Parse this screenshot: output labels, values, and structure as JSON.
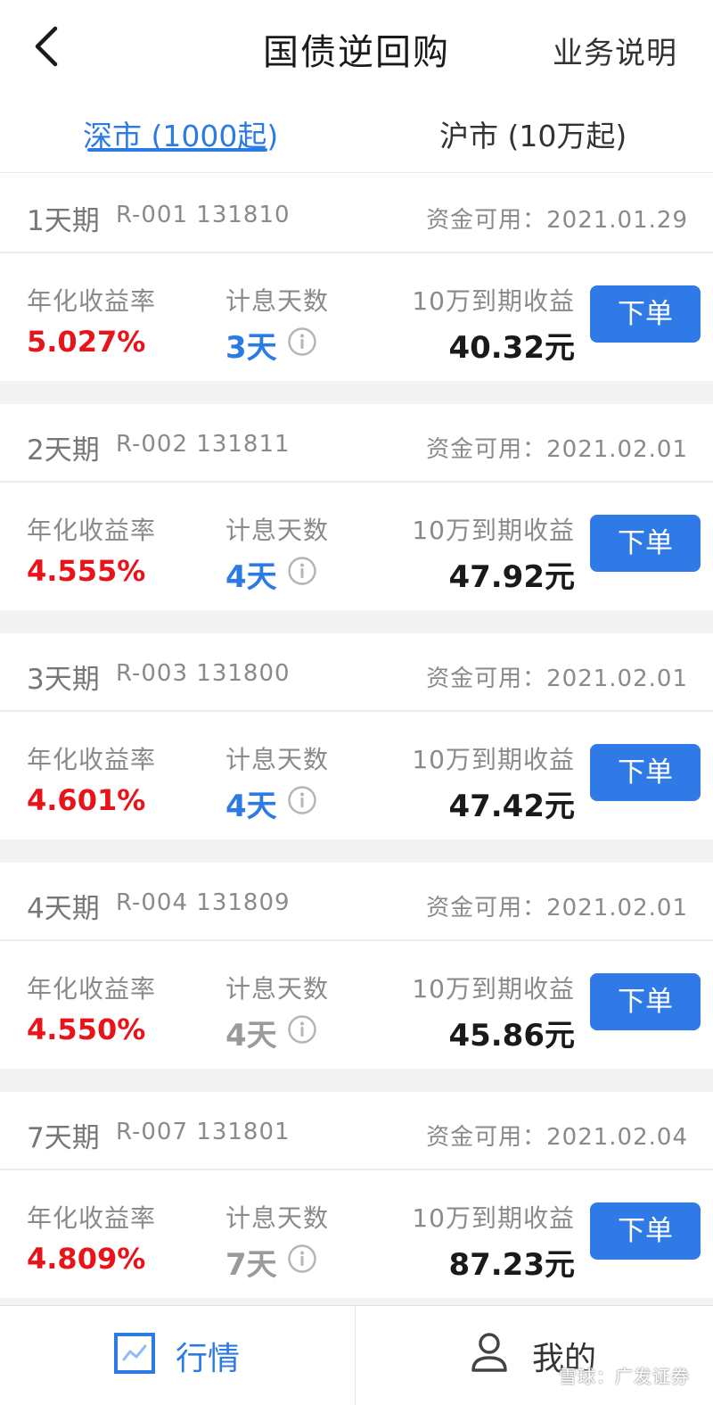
{
  "header": {
    "title": "国债逆回购",
    "help_label": "业务说明"
  },
  "tabs": [
    {
      "label": "深市 (1000起)"
    },
    {
      "label": "沪市 (10万起)"
    }
  ],
  "labels": {
    "rate": "年化收益率",
    "days": "计息天数",
    "income": "10万到期收益",
    "order": "下单"
  },
  "products": [
    {
      "term": "1天期",
      "code": "R-001 131810",
      "available": "资金可用：2021.01.29",
      "rate": "5.027%",
      "days": "3天",
      "income": "40.32元"
    },
    {
      "term": "2天期",
      "code": "R-002 131811",
      "available": "资金可用：2021.02.01",
      "rate": "4.555%",
      "days": "4天",
      "income": "47.92元"
    },
    {
      "term": "3天期",
      "code": "R-003 131800",
      "available": "资金可用：2021.02.01",
      "rate": "4.601%",
      "days": "4天",
      "income": "47.42元"
    },
    {
      "term": "4天期",
      "code": "R-004 131809",
      "available": "资金可用：2021.02.01",
      "rate": "4.550%",
      "days": "4天",
      "income": "45.86元"
    },
    {
      "term": "7天期",
      "code": "R-007 131801",
      "available": "资金可用：2021.02.04",
      "rate": "4.809%",
      "days": "7天",
      "income": "87.23元"
    }
  ],
  "bottom_nav": {
    "market_label": "行情",
    "mine_label": "我的"
  },
  "watermark": "雪球：广发证券",
  "colors": {
    "accent": "#2c7be5",
    "rate_red": "#e8141a",
    "button": "#2f7ae6"
  },
  "icons": {
    "back": "chevron-left-icon",
    "info": "info-circle-icon",
    "market": "chart-icon",
    "mine": "user-icon"
  }
}
